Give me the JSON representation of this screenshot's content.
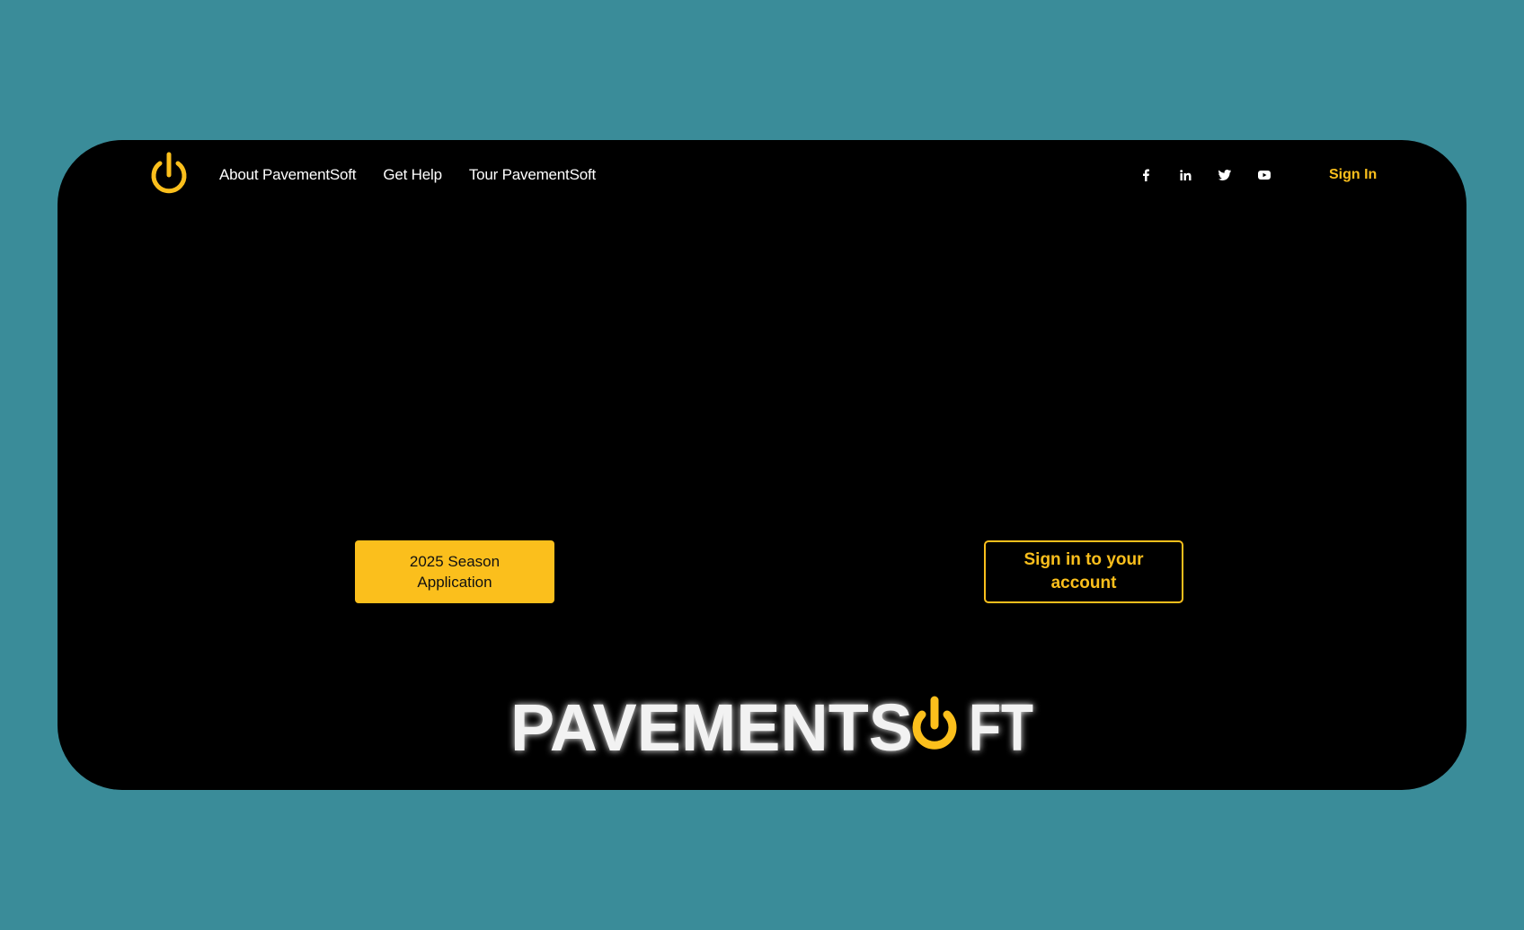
{
  "nav": {
    "items": [
      {
        "label": "About PavementSoft"
      },
      {
        "label": "Get Help"
      },
      {
        "label": "Tour PavementSoft"
      }
    ],
    "social_icons": [
      "facebook-icon",
      "linkedin-icon",
      "twitter-icon",
      "youtube-icon"
    ],
    "signin_label": "Sign In"
  },
  "hero": {
    "primary_button": "2025 Season\nApplication",
    "secondary_button": "Sign in to your\naccount"
  },
  "brand": {
    "wordmark": "PAVEMENTSOFT"
  },
  "colors": {
    "accent": "#fbbf1c",
    "background": "#3a8c99",
    "card": "#000000"
  }
}
